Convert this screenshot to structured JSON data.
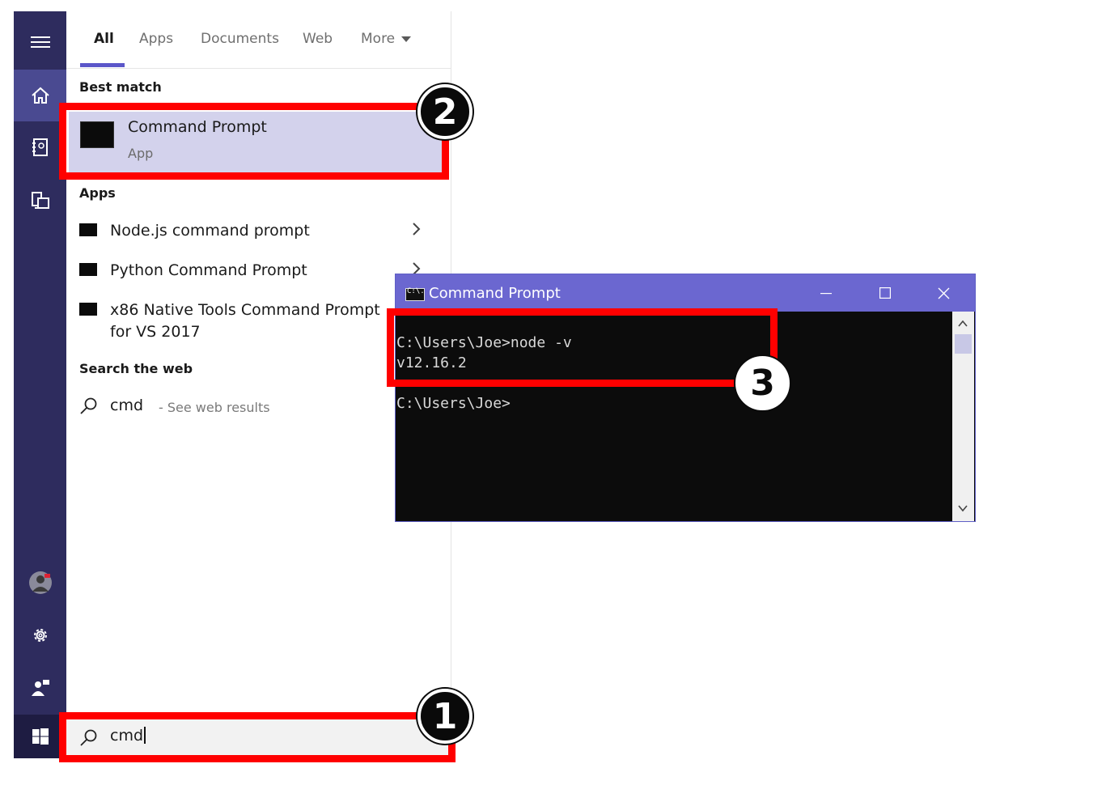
{
  "rail": {
    "icons": [
      "hamburger-menu-icon",
      "home-icon",
      "notebook-icon",
      "devices-icon",
      "avatar",
      "gear-icon",
      "feedback-icon",
      "windows-logo-icon"
    ]
  },
  "tabs": [
    {
      "label": "All",
      "active": true
    },
    {
      "label": "Apps"
    },
    {
      "label": "Documents"
    },
    {
      "label": "Web"
    },
    {
      "label": "More"
    }
  ],
  "best_match": {
    "heading": "Best match",
    "title": "Command Prompt",
    "subtitle": "App"
  },
  "apps": {
    "heading": "Apps",
    "items": [
      {
        "label": "Node.js command prompt"
      },
      {
        "label": "Python Command Prompt"
      },
      {
        "label": "x86 Native Tools Command Prompt for VS 2017"
      }
    ]
  },
  "web": {
    "heading": "Search the web",
    "query": "cmd",
    "hint": "- See web results"
  },
  "search": {
    "value": "cmd"
  },
  "console": {
    "title": "Command Prompt",
    "icon_text": "C:\\.",
    "lines": [
      "C:\\Users\\Joe>node -v",
      "v12.16.2",
      "",
      "C:\\Users\\Joe>"
    ]
  },
  "annotations": {
    "badge1": "1",
    "badge2": "2",
    "badge3": "3",
    "highlight_color": "#ff0000"
  },
  "colors": {
    "rail": "#2e2c5e",
    "accent": "#5b57c9",
    "titlebar": "#6b67d0",
    "selection": "#d3d2ec"
  }
}
